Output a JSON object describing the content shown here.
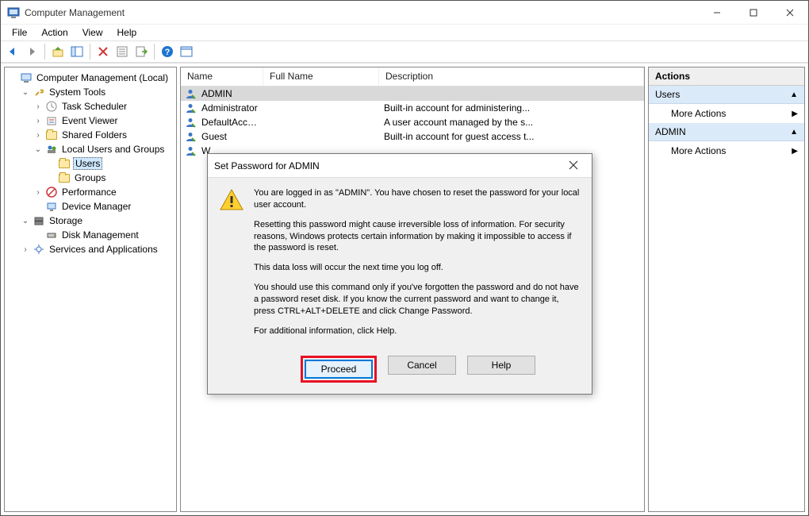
{
  "window": {
    "title": "Computer Management"
  },
  "menu": {
    "file": "File",
    "action": "Action",
    "view": "View",
    "help": "Help"
  },
  "tree": {
    "root": "Computer Management (Local)",
    "system_tools": "System Tools",
    "task_scheduler": "Task Scheduler",
    "event_viewer": "Event Viewer",
    "shared_folders": "Shared Folders",
    "local_users_groups": "Local Users and Groups",
    "users": "Users",
    "groups": "Groups",
    "performance": "Performance",
    "device_manager": "Device Manager",
    "storage": "Storage",
    "disk_management": "Disk Management",
    "services_apps": "Services and Applications"
  },
  "list": {
    "headers": {
      "name": "Name",
      "full_name": "Full Name",
      "description": "Description"
    },
    "rows": [
      {
        "name": "ADMIN",
        "full": "",
        "desc": "",
        "selected": true
      },
      {
        "name": "Administrator",
        "full": "",
        "desc": "Built-in account for administering..."
      },
      {
        "name": "DefaultAcco...",
        "full": "",
        "desc": "A user account managed by the s..."
      },
      {
        "name": "Guest",
        "full": "",
        "desc": "Built-in account for guest access t..."
      },
      {
        "name": "W",
        "full": "",
        "desc": "",
        "truncated": true
      }
    ]
  },
  "actions": {
    "title": "Actions",
    "section1": "Users",
    "section2": "ADMIN",
    "more": "More Actions"
  },
  "dialog": {
    "title": "Set Password for ADMIN",
    "p1": "You are logged in as \"ADMIN\". You have chosen to reset the password for your local user account.",
    "p2": "Resetting this password might cause irreversible loss of information. For security reasons, Windows protects certain information by making it impossible to access if the password is reset.",
    "p3": "This data loss will occur the next time you log off.",
    "p4": "You should use this command only if you've forgotten the password and do not have a password reset disk. If you know the current password and want to change it, press CTRL+ALT+DELETE and click Change Password.",
    "p5": "For additional information, click Help.",
    "proceed": "Proceed",
    "cancel": "Cancel",
    "help": "Help"
  }
}
